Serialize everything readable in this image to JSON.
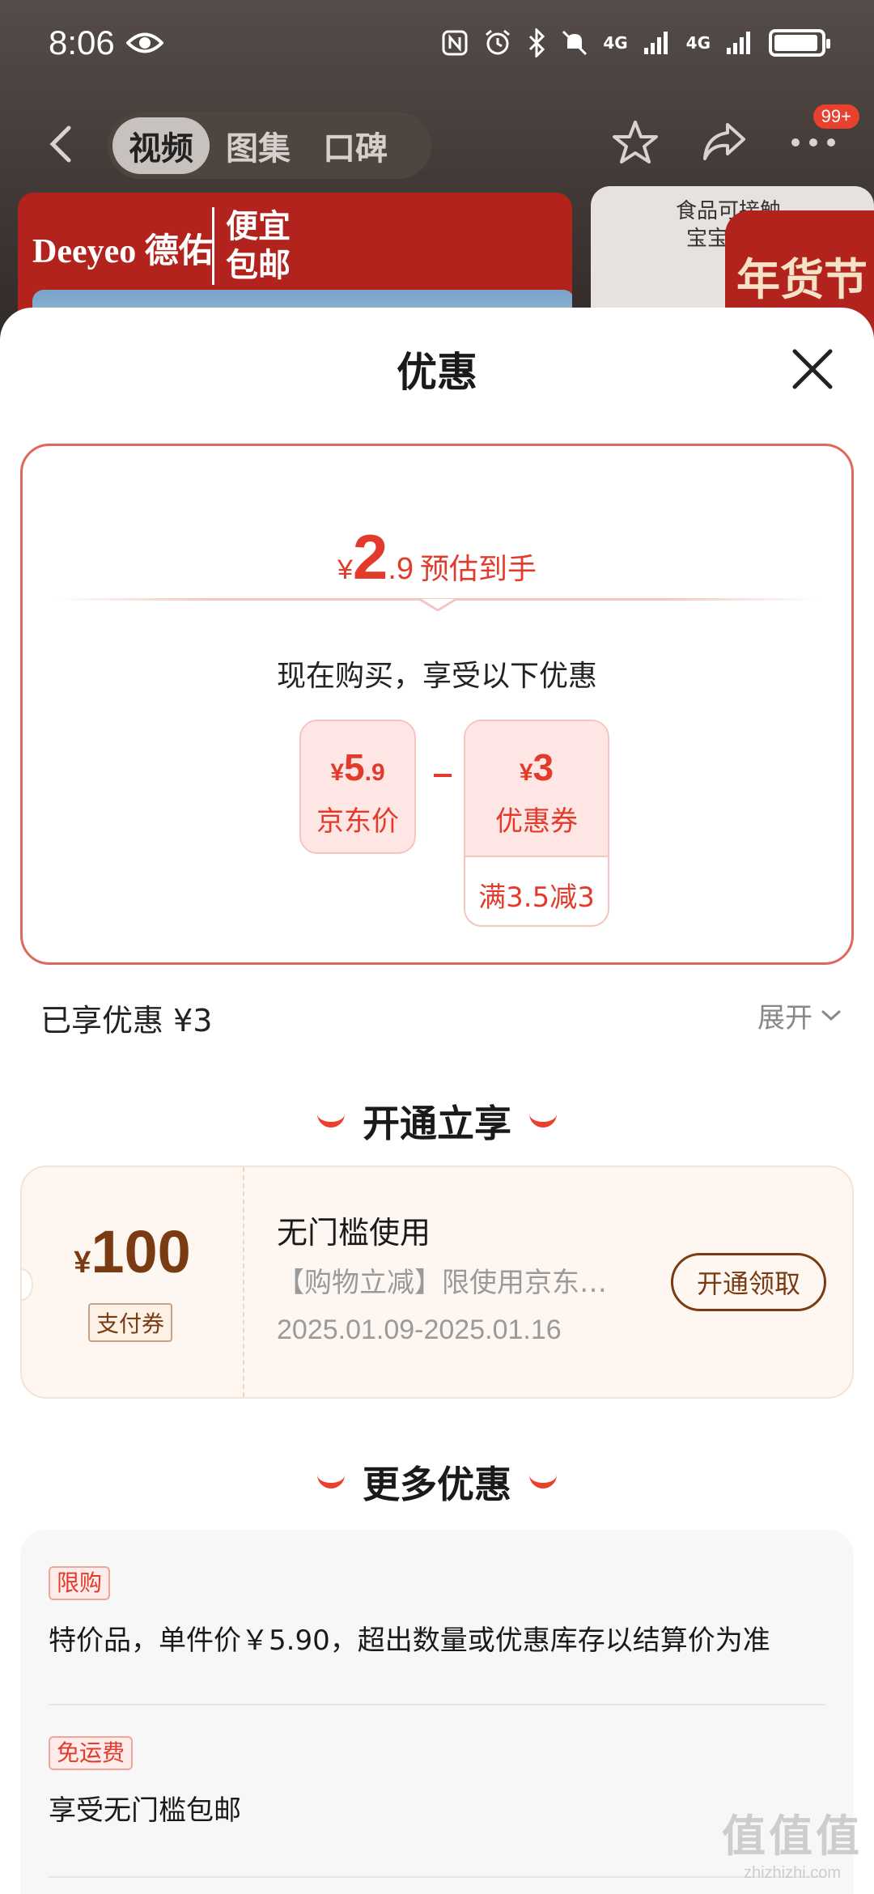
{
  "status_bar": {
    "time": "8:06",
    "network_1": "4G",
    "network_2": "4G",
    "icons": [
      "eye-icon",
      "nfc-icon",
      "alarm-icon",
      "bluetooth-icon",
      "mute-icon",
      "signal-icon",
      "signal-icon",
      "battery-icon"
    ]
  },
  "nav": {
    "tabs": [
      {
        "label": "视频",
        "active": true
      },
      {
        "label": "图集",
        "active": false
      },
      {
        "label": "口碑",
        "active": false
      }
    ],
    "more_badge": "99+"
  },
  "background": {
    "banner_brand": "Deeyeo 德佑",
    "banner_tag_line1": "便宜",
    "banner_tag_line2": "包邮",
    "side_card_line1": "食品可接触",
    "side_card_line2": "宝宝擦嘴",
    "side_card_stamp": "年货节"
  },
  "sheet": {
    "title": "优惠",
    "estimate": {
      "currency": "¥",
      "integer": "2",
      "decimal": ".9",
      "label": "预估到手"
    },
    "buy_now_text": "现在购买，享受以下优惠",
    "jd_price": {
      "currency": "¥",
      "integer": "5",
      "decimal": ".9",
      "label": "京东价"
    },
    "coupon": {
      "currency": "¥",
      "integer": "3",
      "label": "优惠券",
      "condition": "满3.5减3"
    },
    "enjoyed": "已享优惠 ¥3",
    "expand_label": "展开",
    "open_section_title": "开通立享",
    "vip_coupon": {
      "currency": "¥",
      "amount": "100",
      "type": "支付券",
      "title": "无门槛使用",
      "description": "【购物立减】限使用京东…",
      "date_range": "2025.01.09-2025.01.16",
      "button": "开通领取"
    },
    "more_section_title": "更多优惠",
    "more_items": [
      {
        "tag": "限购",
        "text": "特价品，单件价￥5.90，超出数量或优惠库存以结算价为准"
      },
      {
        "tag": "免运费",
        "text": "享受无门槛包邮"
      }
    ]
  },
  "watermark": {
    "logo": "值值值",
    "text": "zhizhizhi.com"
  },
  "colors": {
    "accent_red": "#e23b2b",
    "brown": "#7a3b12",
    "vip_bg": "#fef7f1"
  }
}
